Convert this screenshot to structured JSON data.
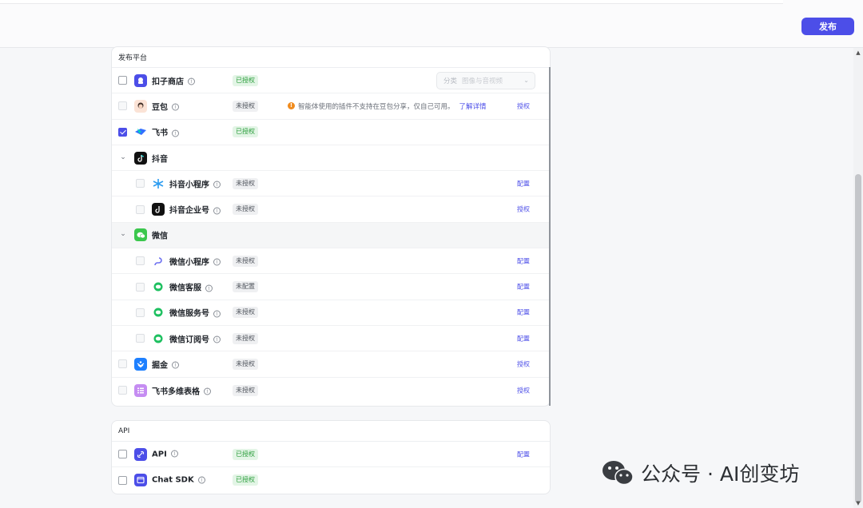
{
  "header": {
    "publish_label": "发布"
  },
  "platforms_card": {
    "title": "发布平台",
    "category_select": {
      "label": "分类",
      "placeholder": "图像与音视频"
    },
    "rows": [
      {
        "name": "扣子商店",
        "badge": "已授权",
        "status": "ok",
        "action": "",
        "checkbox": "unchecked",
        "logo": "coze-store-icon"
      },
      {
        "name": "豆包",
        "badge": "未授权",
        "status": "no",
        "action": "授权",
        "checkbox": "disabled",
        "logo": "doubao-icon",
        "warning": {
          "text": "智能体使用的插件不支持在豆包分享，仅自己可用。",
          "link": "了解详情"
        }
      },
      {
        "name": "飞书",
        "badge": "已授权",
        "status": "ok",
        "action": "",
        "checkbox": "checked",
        "logo": "feishu-icon"
      },
      {
        "name": "抖音",
        "group": true,
        "logo": "douyin-icon"
      },
      {
        "name": "抖音小程序",
        "badge": "未授权",
        "status": "no",
        "action": "配置",
        "checkbox": "disabled",
        "logo": "douyin-miniapp-icon",
        "child": true
      },
      {
        "name": "抖音企业号",
        "badge": "未授权",
        "status": "no",
        "action": "授权",
        "checkbox": "disabled",
        "logo": "douyin-enterprise-icon",
        "child": true
      },
      {
        "name": "微信",
        "group": true,
        "logo": "wechat-icon"
      },
      {
        "name": "微信小程序",
        "badge": "未授权",
        "status": "no",
        "action": "配置",
        "checkbox": "disabled",
        "logo": "wechat-miniapp-icon",
        "child": true
      },
      {
        "name": "微信客服",
        "badge": "未配置",
        "status": "no",
        "action": "配置",
        "checkbox": "disabled",
        "logo": "wechat-service-icon",
        "child": true
      },
      {
        "name": "微信服务号",
        "badge": "未授权",
        "status": "no",
        "action": "配置",
        "checkbox": "disabled",
        "logo": "wechat-service-account-icon",
        "child": true
      },
      {
        "name": "微信订阅号",
        "badge": "未授权",
        "status": "no",
        "action": "配置",
        "checkbox": "disabled",
        "logo": "wechat-subscription-icon",
        "child": true
      },
      {
        "name": "掘金",
        "badge": "未授权",
        "status": "no",
        "action": "授权",
        "checkbox": "disabled",
        "logo": "juejin-icon"
      },
      {
        "name": "飞书多维表格",
        "badge": "未授权",
        "status": "no",
        "action": "授权",
        "checkbox": "disabled",
        "logo": "feishu-bitable-icon"
      }
    ]
  },
  "api_card": {
    "title": "API",
    "rows": [
      {
        "name": "API",
        "badge": "已授权",
        "status": "ok",
        "action": "配置",
        "checkbox": "unchecked",
        "logo": "api-link-icon"
      },
      {
        "name": "Chat SDK",
        "badge": "已授权",
        "status": "ok",
        "action": "",
        "checkbox": "unchecked",
        "logo": "chat-sdk-icon"
      }
    ]
  },
  "watermark": {
    "text": "公众号 · AI创变坊"
  },
  "colors": {
    "accent": "#4c4ee8",
    "authorized_bg": "#e3f5e6",
    "authorized_text": "#2a9d3b",
    "warning": "#f08b1d"
  }
}
